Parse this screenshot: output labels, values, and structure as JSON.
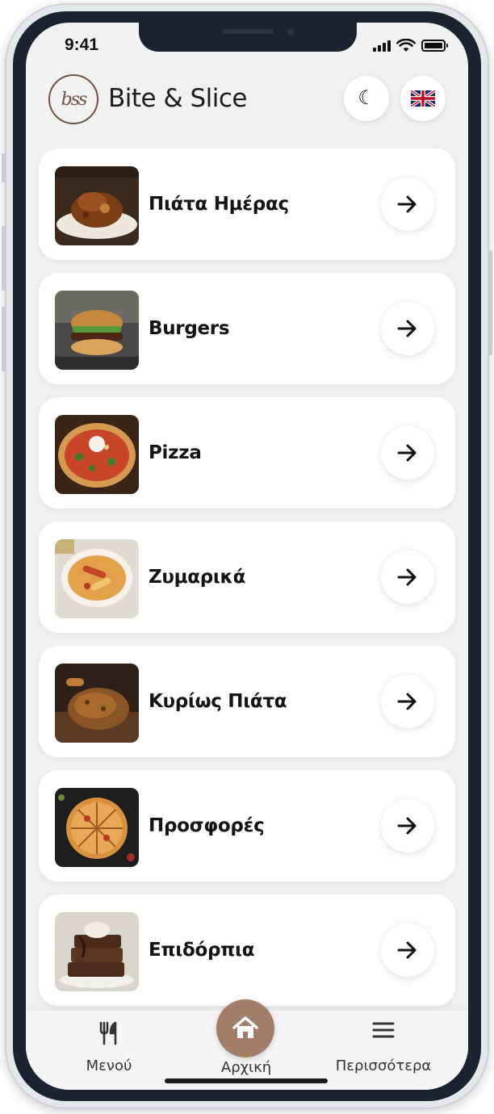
{
  "status_bar": {
    "time": "9:41"
  },
  "header": {
    "logo_text": "bss",
    "brand_name": "Bite & Slice",
    "theme_icon": "moon-icon",
    "language_icon": "uk-flag-icon"
  },
  "menu": {
    "items": [
      {
        "label": "Πιάτα Ημέρας",
        "image": "daily-dish-photo"
      },
      {
        "label": "Burgers",
        "image": "burger-photo"
      },
      {
        "label": "Pizza",
        "image": "pizza-photo"
      },
      {
        "label": "Ζυμαρικά",
        "image": "pasta-photo"
      },
      {
        "label": "Κυρίως Πιάτα",
        "image": "main-course-photo"
      },
      {
        "label": "Προσφορές",
        "image": "offers-photo"
      },
      {
        "label": "Επιδόρπια",
        "image": "dessert-photo"
      }
    ]
  },
  "bottom_nav": {
    "menu_label": "Μενού",
    "home_label": "Αρχική",
    "more_label": "Περισσότερα"
  },
  "colors": {
    "accent": "#a07e69",
    "logo": "#6b5246",
    "background": "#f1f1f1",
    "card": "#ffffff",
    "bezel": "#1d2230"
  }
}
